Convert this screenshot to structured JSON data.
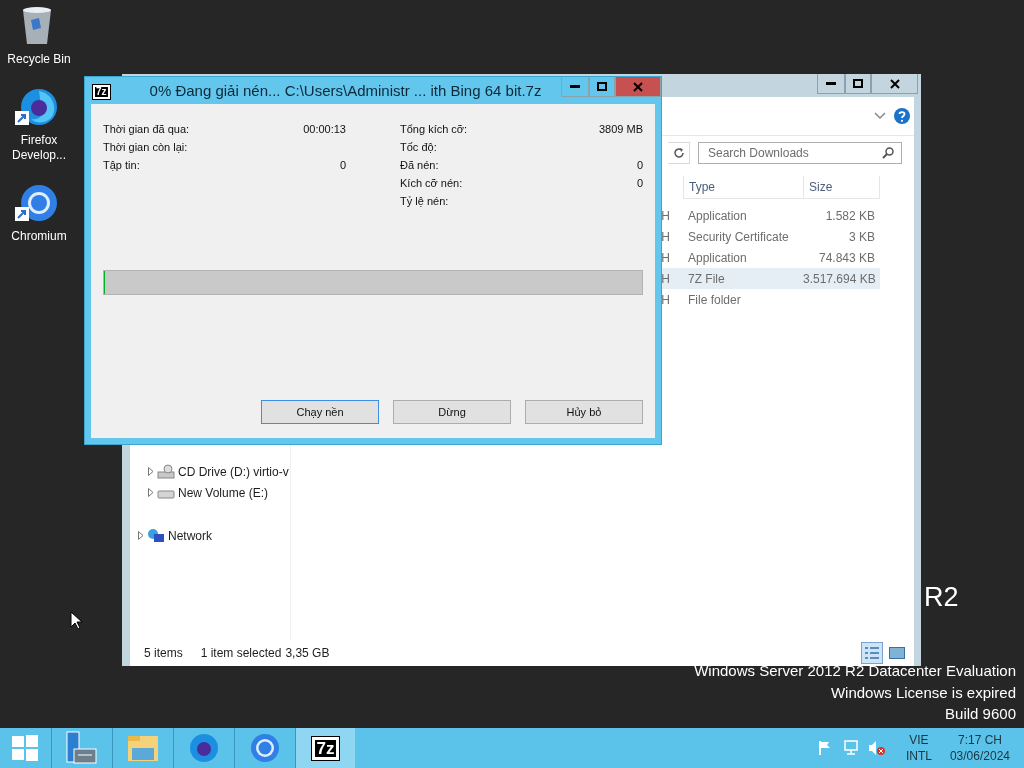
{
  "desktop": {
    "icons": [
      {
        "kind": "recycle",
        "label": "Recycle Bin",
        "shortcut": false
      },
      {
        "kind": "firefox",
        "label": "Firefox Develop...",
        "shortcut": true
      },
      {
        "kind": "chromium",
        "label": "Chromium",
        "shortcut": true
      }
    ],
    "logo_fragment": "R2",
    "lines": [
      "Windows Server 2012 R2 Datacenter Evaluation",
      "Windows License is expired",
      "Build 9600"
    ]
  },
  "explorer": {
    "search": {
      "placeholder": "Search Downloads"
    },
    "columns": [
      {
        "label": "Type"
      },
      {
        "label": "Size"
      }
    ],
    "rows": [
      {
        "column_1": "H",
        "type": "Application",
        "size": "1.582 KB",
        "selected": false
      },
      {
        "column_1": "H",
        "type": "Security Certificate",
        "size": "3 KB",
        "selected": false
      },
      {
        "column_1": "H",
        "type": "Application",
        "size": "74.843 KB",
        "selected": false
      },
      {
        "column_1": "H",
        "type": "7Z File",
        "size": "3.517.694 KB",
        "selected": true
      },
      {
        "column_1": "H",
        "type": "File folder",
        "selected": false
      }
    ],
    "nav": [
      {
        "kind": "cd",
        "label": "CD Drive (D:) virtio-v"
      },
      {
        "kind": "drive",
        "label": "New Volume (E:)"
      },
      {
        "kind": "network",
        "label": "Network"
      }
    ],
    "status": {
      "count": "5 items",
      "selection": "1 item selected",
      "selection_size": "3,35 GB"
    },
    "views": [
      {
        "kind": "details",
        "selected": true
      },
      {
        "kind": "preview",
        "selected": false
      }
    ]
  },
  "dialog": {
    "icon_text": "7z",
    "title": "0% Đang giải nén... C:\\Users\\Administr ... ith Bing 64 bit.7z",
    "left_stats": [
      {
        "label": "Thời gian đã qua:",
        "value": "00:00:13"
      },
      {
        "label": "Thời gian còn lại:"
      },
      {
        "label": "Tập tin:",
        "value": "0"
      }
    ],
    "right_stats": [
      {
        "label": "Tổng kích cỡ:",
        "value": "3809 MB"
      },
      {
        "label": "Tốc độ:"
      },
      {
        "label": "Đã nén:",
        "value": "0"
      },
      {
        "label": "Kích cỡ nén:",
        "value": "0"
      },
      {
        "label": "Tỷ lệ nén:"
      }
    ],
    "progress": {
      "level": 0
    },
    "buttons": [
      "Chạy nền",
      "Dừng",
      "Hủy bỏ"
    ]
  },
  "taskbar": {
    "apps": [
      {
        "kind": "server",
        "selected": false
      },
      {
        "kind": "folder",
        "selected": false
      },
      {
        "kind": "firefox",
        "selected": false
      },
      {
        "kind": "chromium",
        "selected": false
      },
      {
        "kind": "sevenzip",
        "text": "7z",
        "selected": true
      }
    ],
    "language": [
      "VIE",
      "INTL"
    ],
    "clock": [
      "7:17 CH",
      "03/06/2024"
    ]
  }
}
